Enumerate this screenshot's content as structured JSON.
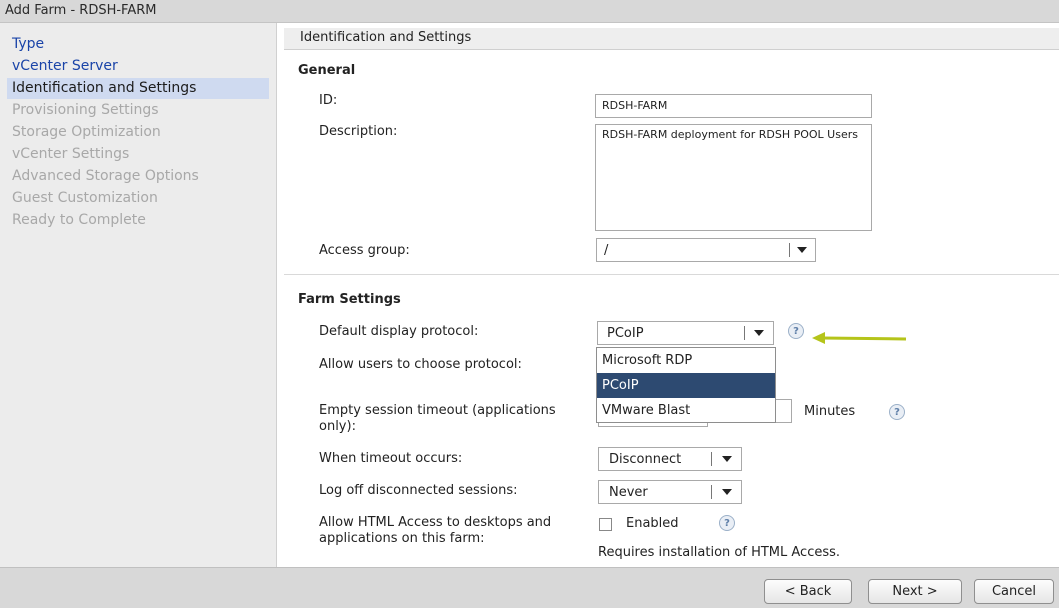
{
  "window": {
    "title": "Add Farm - RDSH-FARM"
  },
  "sidebar": {
    "items": [
      {
        "label": "Type",
        "state": "link"
      },
      {
        "label": "vCenter Server",
        "state": "link"
      },
      {
        "label": "Identification and Settings",
        "state": "active"
      },
      {
        "label": "Provisioning Settings",
        "state": "disabled"
      },
      {
        "label": "Storage Optimization",
        "state": "disabled"
      },
      {
        "label": "vCenter Settings",
        "state": "disabled"
      },
      {
        "label": "Advanced Storage Options",
        "state": "disabled"
      },
      {
        "label": "Guest Customization",
        "state": "disabled"
      },
      {
        "label": "Ready to Complete",
        "state": "disabled"
      }
    ]
  },
  "main": {
    "header": "Identification and Settings",
    "general": {
      "title": "General",
      "id_label": "ID:",
      "id_value": "RDSH-FARM",
      "description_label": "Description:",
      "description_value": "RDSH-FARM deployment for RDSH POOL Users",
      "access_group_label": "Access group:",
      "access_group_value": "/"
    },
    "farm_settings": {
      "title": "Farm Settings",
      "protocol_label": "Default display protocol:",
      "protocol_value": "PCoIP",
      "protocol_options": [
        "Microsoft RDP",
        "PCoIP",
        "VMware Blast"
      ],
      "protocol_selected_index": 1,
      "allow_choose_label": "Allow users to choose protocol:",
      "empty_timeout_label": "Empty session timeout (applications only):",
      "minutes_label": "Minutes",
      "when_timeout_label": "When timeout occurs:",
      "when_timeout_value": "Disconnect",
      "logoff_label": "Log off disconnected sessions:",
      "logoff_value": "Never",
      "html_access_label": "Allow HTML Access to desktops and applications on this farm:",
      "html_enabled_label": "Enabled",
      "html_enabled_checked": false,
      "html_note": "Requires installation of HTML Access."
    }
  },
  "footer": {
    "back": "< Back",
    "next": "Next >",
    "cancel": "Cancel"
  },
  "icons": {
    "help": "?"
  },
  "colors": {
    "arrow": "#b5c41a",
    "selected": "#2d4a71",
    "link": "#1a44a8"
  }
}
